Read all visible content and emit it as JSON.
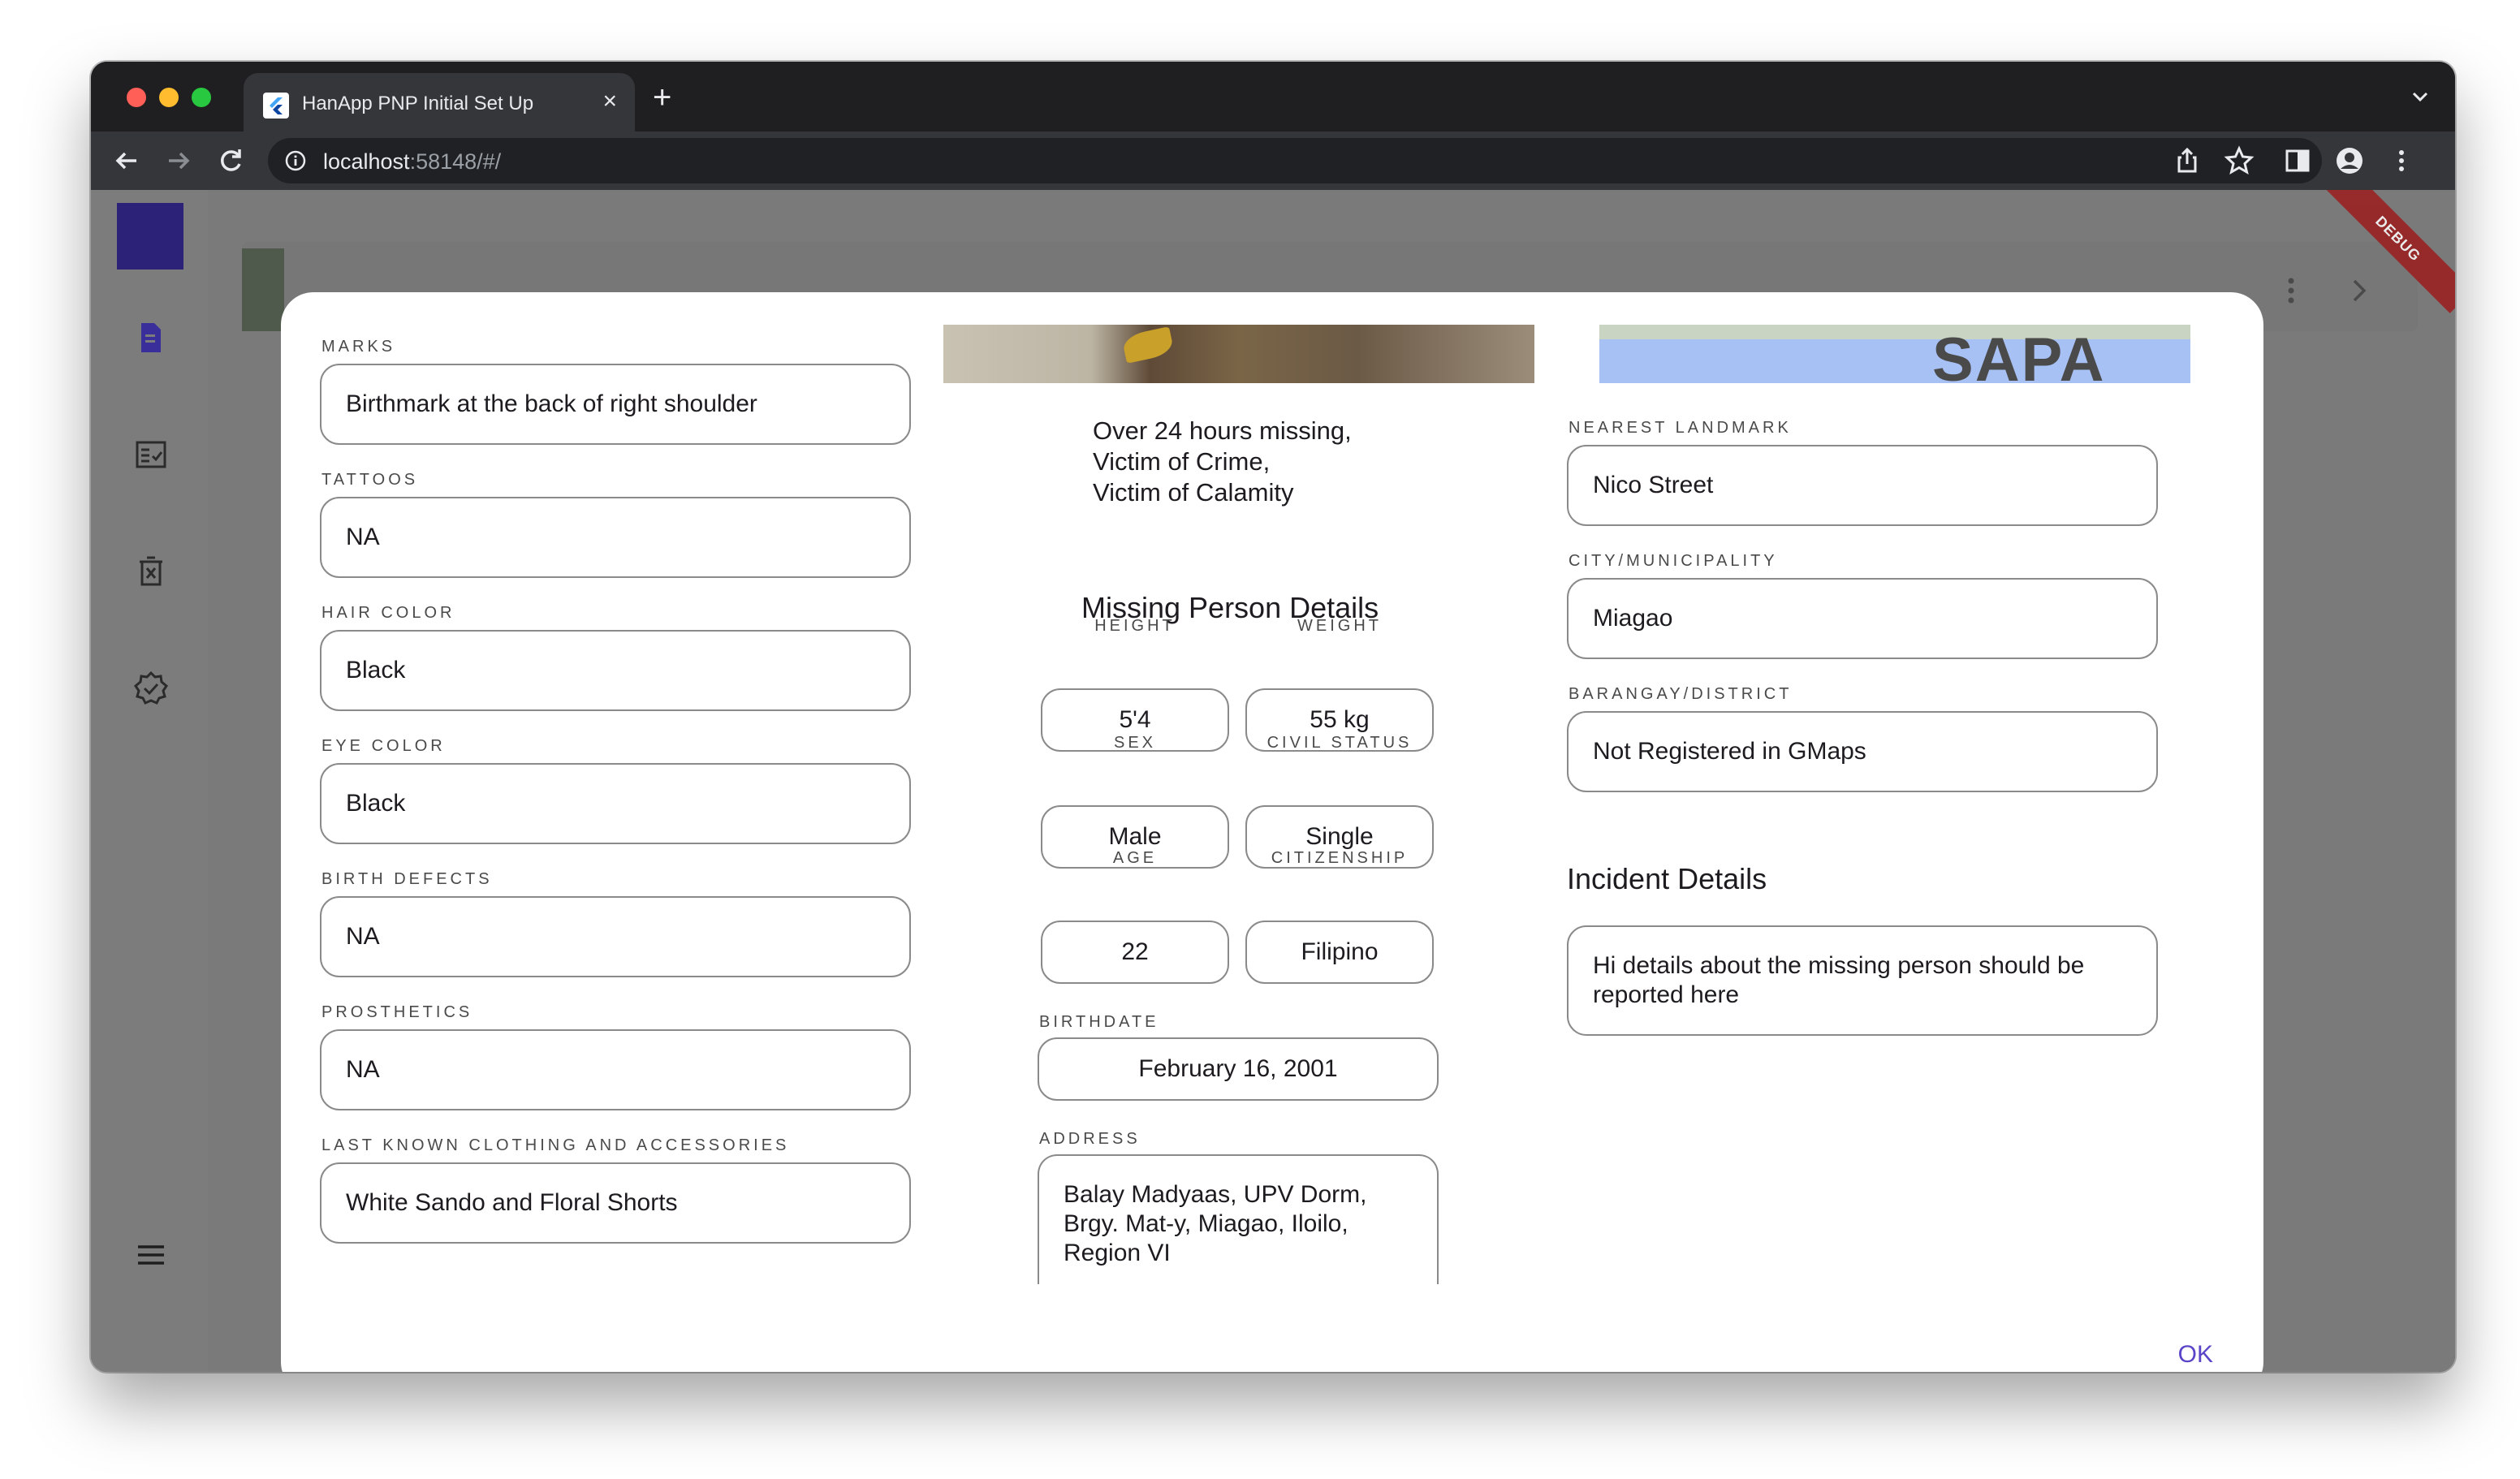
{
  "browser": {
    "tab_title": "HanApp PNP Initial Set Up",
    "url_host": "localhost",
    "url_path": ":58148/#/"
  },
  "debug_banner": "DEBUG",
  "dialog": {
    "left_fields": [
      {
        "label": "MARKS",
        "value": "Birthmark at the back of right shoulder"
      },
      {
        "label": "TATTOOS",
        "value": "NA"
      },
      {
        "label": "HAIR COLOR",
        "value": "Black"
      },
      {
        "label": "EYE COLOR",
        "value": "Black"
      },
      {
        "label": "BIRTH DEFECTS",
        "value": "NA"
      },
      {
        "label": "PROSTHETICS",
        "value": "NA"
      },
      {
        "label": "LAST KNOWN CLOTHING AND ACCESSORIES",
        "value": "White Sando and Floral Shorts"
      }
    ],
    "status_lines": [
      "Over 24 hours missing,",
      "Victim of Crime,",
      "Victim of Calamity"
    ],
    "missing_title": "Missing Person Details",
    "pairs": [
      {
        "l_label": "HEIGHT",
        "l_value": "5'4",
        "r_label": "WEIGHT",
        "r_value": "55 kg"
      },
      {
        "l_label": "SEX",
        "l_value": "Male",
        "r_label": "CIVIL STATUS",
        "r_value": "Single"
      },
      {
        "l_label": "AGE",
        "l_value": "22",
        "r_label": "CITIZENSHIP",
        "r_value": "Filipino"
      }
    ],
    "birthdate": {
      "label": "BIRTHDATE",
      "value": "February 16, 2001"
    },
    "address": {
      "label": "ADDRESS",
      "lines": [
        "Balay Madyaas, UPV Dorm,",
        "Brgy. Mat-y, Miagao, Iloilo,",
        "Region VI"
      ]
    },
    "map_label": "SAPA",
    "right_fields": [
      {
        "label": "NEAREST LANDMARK",
        "value": "Nico Street"
      },
      {
        "label": "CITY/MUNICIPALITY",
        "value": "Miagao"
      },
      {
        "label": "BARANGAY/DISTRICT",
        "value": "Not Registered in GMaps"
      }
    ],
    "incident_title": "Incident Details",
    "incident_lines": [
      "Hi details about the missing person should be",
      "reported here"
    ],
    "ok_label": "OK"
  },
  "colors": {
    "accent": "#5a45c8",
    "rail_logo": "#2c2278",
    "rail_icon": "#3a2f9a"
  },
  "icons": {
    "rail": [
      "document-icon",
      "checklist-icon",
      "delete-report-icon",
      "verified-icon",
      "menu-icon"
    ],
    "toolbar": [
      "share-icon",
      "star-icon",
      "side-panel-icon",
      "profile-icon",
      "more-vert-icon"
    ]
  }
}
